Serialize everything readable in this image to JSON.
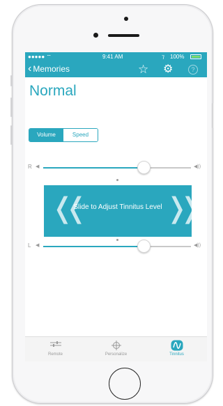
{
  "status_bar": {
    "signal": "●●●●● ⌔",
    "time": "9:41 AM",
    "bluetooth": "⁊",
    "battery_text": "100%"
  },
  "nav": {
    "back_label": "Memories",
    "back_icon": "chevron-left-icon",
    "star_icon": "star-outline-icon",
    "settings_icon": "gear-icon",
    "help_label": "?"
  },
  "page_title": "Normal",
  "mode_toggle": {
    "options": [
      "Volume",
      "Speed"
    ],
    "selected": "Volume"
  },
  "sliders": {
    "right": {
      "side_label": "R",
      "level": 0.68
    },
    "left": {
      "side_label": "L",
      "level": 0.68
    }
  },
  "tinnitus_control": {
    "label": "Slide to Adjust Tinnitus Level"
  },
  "tabs": [
    {
      "label": "Remote",
      "icon": "sliders-icon",
      "active": false
    },
    {
      "label": "Personalize",
      "icon": "crosshair-icon",
      "active": false
    },
    {
      "label": "Tinnitus",
      "icon": "tinnitus-wave-icon",
      "active": true
    }
  ],
  "colors": {
    "accent": "#2aa7be"
  }
}
